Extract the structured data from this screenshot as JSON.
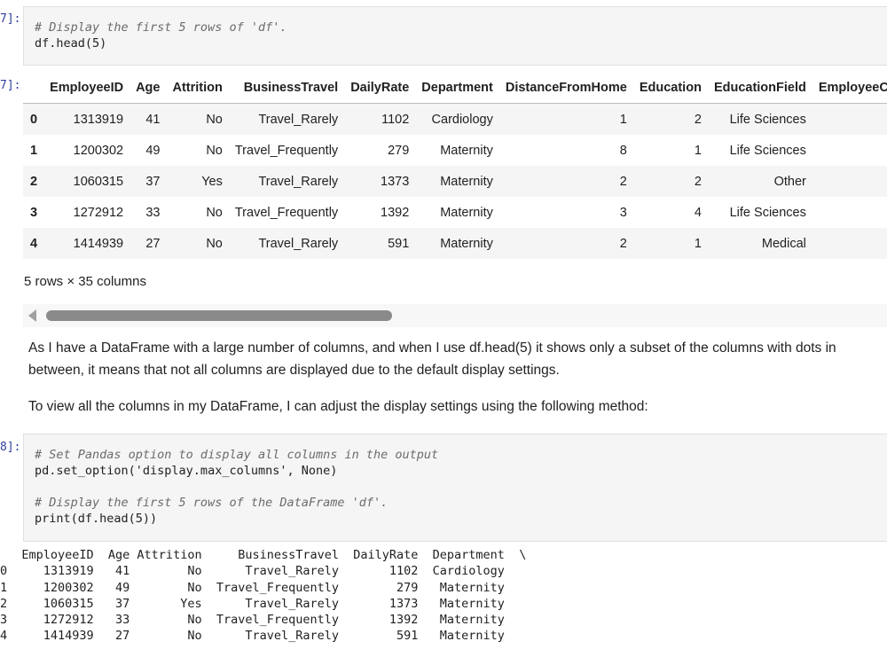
{
  "cells": [
    {
      "prompt": "7]:",
      "code_lines": [
        "# Display the first 5 rows of 'df'.",
        "df.head(5)"
      ]
    },
    {
      "prompt": "8]:",
      "code_lines": [
        "# Set Pandas option to display all columns in the output",
        "pd.set_option('display.max_columns', None)",
        "",
        "# Display the first 5 rows of the DataFrame 'df'.",
        "print(df.head(5))"
      ]
    }
  ],
  "output_prompt": "7]:",
  "dataframe": {
    "columns": [
      "",
      "EmployeeID",
      "Age",
      "Attrition",
      "BusinessTravel",
      "DailyRate",
      "Department",
      "DistanceFromHome",
      "Education",
      "EducationField",
      "EmployeeCo"
    ],
    "rows": [
      [
        "0",
        "1313919",
        "41",
        "No",
        "Travel_Rarely",
        "1102",
        "Cardiology",
        "1",
        "2",
        "Life Sciences",
        ""
      ],
      [
        "1",
        "1200302",
        "49",
        "No",
        "Travel_Frequently",
        "279",
        "Maternity",
        "8",
        "1",
        "Life Sciences",
        ""
      ],
      [
        "2",
        "1060315",
        "37",
        "Yes",
        "Travel_Rarely",
        "1373",
        "Maternity",
        "2",
        "2",
        "Other",
        ""
      ],
      [
        "3",
        "1272912",
        "33",
        "No",
        "Travel_Frequently",
        "1392",
        "Maternity",
        "3",
        "4",
        "Life Sciences",
        ""
      ],
      [
        "4",
        "1414939",
        "27",
        "No",
        "Travel_Rarely",
        "591",
        "Maternity",
        "2",
        "1",
        "Medical",
        ""
      ]
    ],
    "shape_text": "5 rows × 35 columns"
  },
  "markdown": {
    "paragraph1": "As I have a DataFrame with a large number of columns, and when I use df.head(5) it shows only a subset of the columns with dots in between, it means that not all columns are displayed due to the default display settings.",
    "paragraph2": "To view all the columns in my DataFrame, I can adjust the display settings using the following method:"
  },
  "print_output": {
    "lines": [
      "   EmployeeID  Age Attrition     BusinessTravel  DailyRate  Department  \\",
      "0     1313919   41        No      Travel_Rarely       1102  Cardiology   ",
      "1     1200302   49        No  Travel_Frequently        279   Maternity   ",
      "2     1060315   37       Yes      Travel_Rarely       1373   Maternity   ",
      "3     1272912   33        No  Travel_Frequently       1392   Maternity   ",
      "4     1414939   27        No      Travel_Rarely        591   Maternity   "
    ]
  }
}
